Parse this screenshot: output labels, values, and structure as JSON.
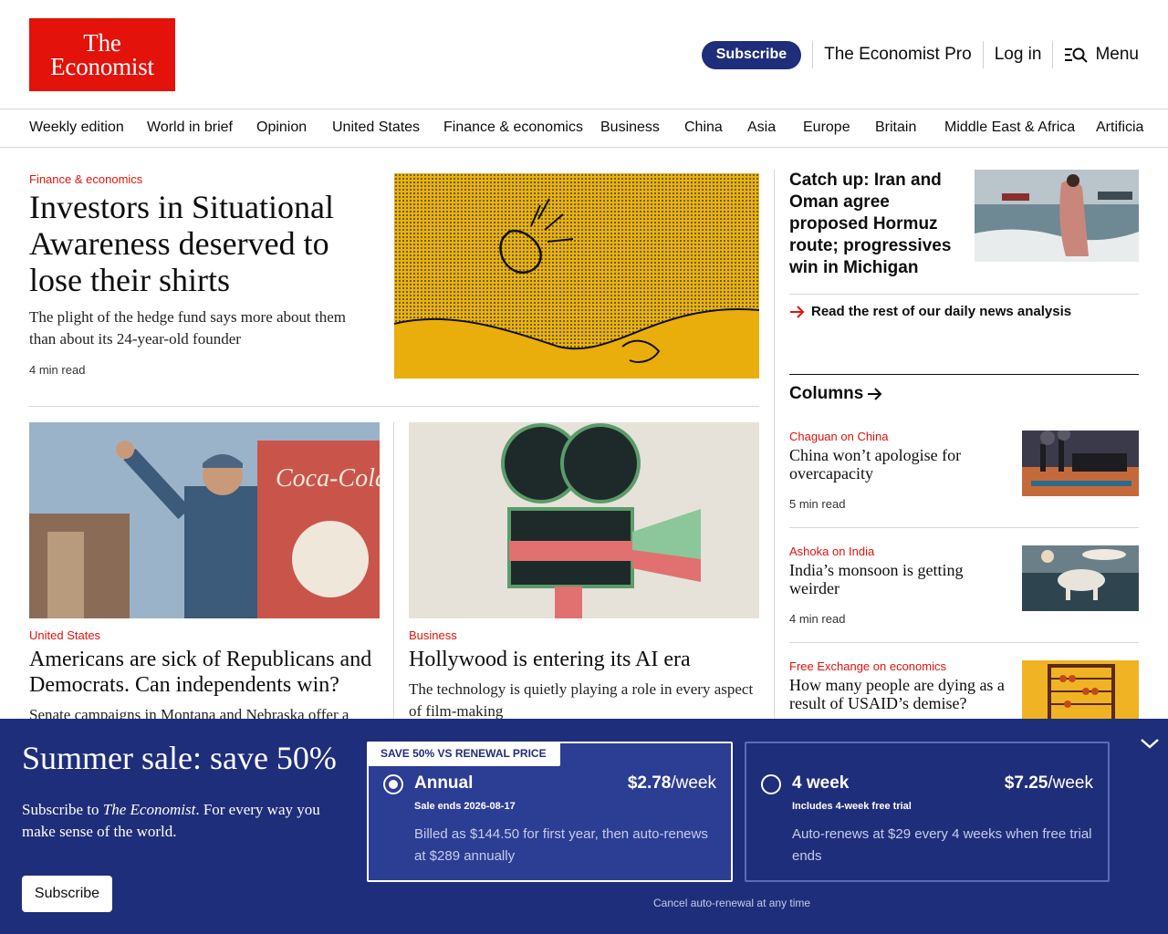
{
  "header": {
    "logo_line1": "The",
    "logo_line2": "Economist",
    "subscribe": "Subscribe",
    "pro": "The Economist Pro",
    "login": "Log in",
    "menu": "Menu"
  },
  "nav": [
    "Weekly edition",
    "World in brief",
    "Opinion",
    "United States",
    "Finance & economics",
    "Business",
    "China",
    "Asia",
    "Europe",
    "Britain",
    "Middle East & Africa",
    "Artificia"
  ],
  "lead": {
    "kicker": "Finance & economics",
    "title": "Investors in Situational Awareness deserved to lose their shirts",
    "desc": "The plight of the hedge fund says more about them than about its 24-year-old founder",
    "read": "4 min read"
  },
  "stories": [
    {
      "kicker": "United States",
      "title": "Americans are sick of Republicans and Democrats. Can independents win?",
      "desc": "Senate campaigns in Montana and Nebraska offer a"
    },
    {
      "kicker": "Business",
      "title": "Hollywood is entering its AI era",
      "desc": "The technology is quietly playing a role in every aspect of film-making"
    }
  ],
  "catchup": {
    "title": "Catch up: Iran and Oman agree proposed Hormuz route; progressives win in Michigan",
    "link": "Read the rest of our daily news analysis"
  },
  "columns": {
    "heading": "Columns",
    "items": [
      {
        "kicker": "Chaguan on China",
        "title": "China won’t apologise for overcapacity",
        "read": "5 min read"
      },
      {
        "kicker": "Ashoka on India",
        "title": "India’s monsoon is getting weirder",
        "read": "4 min read"
      },
      {
        "kicker": "Free Exchange on economics",
        "title": "How many people are dying as a result of USAID’s demise?",
        "read": ""
      }
    ]
  },
  "paywall": {
    "title": "Summer sale: save 50%",
    "text_prefix": "Subscribe to ",
    "text_brand": "The Economist",
    "text_suffix": ". For every way you make sense of the world.",
    "button": "Subscribe",
    "cancel": "Cancel auto-renewal at any time",
    "plans": [
      {
        "badge": "SAVE 50% VS RENEWAL PRICE",
        "name": "Annual",
        "price": "$2.78",
        "unit": "/week",
        "sub": "Sale ends 2026-08-17",
        "desc": "Billed as $144.50 for first year, then auto-renews at $289 annually",
        "selected": true
      },
      {
        "name": "4 week",
        "price": "$7.25",
        "unit": "/week",
        "sub": "Includes 4-week free trial",
        "desc": "Auto-renews at $29 every 4 weeks when free trial ends",
        "selected": false
      }
    ]
  },
  "colors": {
    "brand_red": "#e3120b",
    "brand_navy": "#1f2e7a"
  },
  "icons": [
    "search-menu-icon",
    "arrow-right-icon",
    "chevron-down-icon"
  ]
}
